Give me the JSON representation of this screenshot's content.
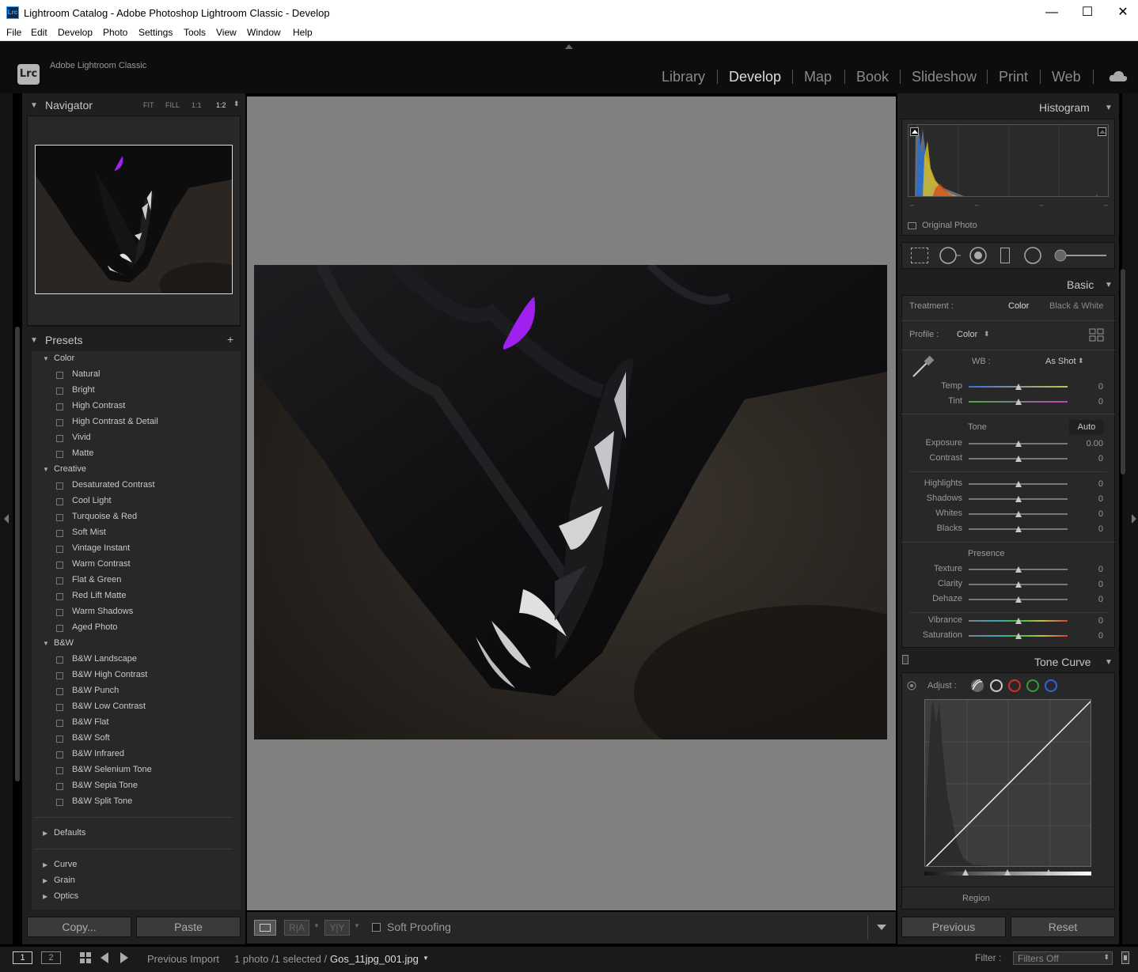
{
  "window": {
    "title": "Lightroom Catalog - Adobe Photoshop Lightroom Classic - Develop",
    "app_icon_text": "Lrc",
    "minimize": "—",
    "maximize": "☐",
    "close": "✕"
  },
  "menu": [
    "File",
    "Edit",
    "Develop",
    "Photo",
    "Settings",
    "Tools",
    "View",
    "Window",
    "Help"
  ],
  "identity": {
    "badge": "Lrc",
    "brand": "Adobe Lightroom Classic"
  },
  "modules": [
    "Library",
    "Develop",
    "Map",
    "Book",
    "Slideshow",
    "Print",
    "Web"
  ],
  "active_module": "Develop",
  "navigator": {
    "title": "Navigator",
    "zoom": [
      "FIT",
      "FILL",
      "1:1",
      "1:2"
    ],
    "active_zoom": "1:2"
  },
  "presets": {
    "title": "Presets",
    "groups": [
      {
        "name": "Color",
        "items": [
          "Natural",
          "Bright",
          "High Contrast",
          "High Contrast & Detail",
          "Vivid",
          "Matte"
        ]
      },
      {
        "name": "Creative",
        "items": [
          "Desaturated Contrast",
          "Cool Light",
          "Turquoise & Red",
          "Soft Mist",
          "Vintage Instant",
          "Warm Contrast",
          "Flat & Green",
          "Red Lift Matte",
          "Warm Shadows",
          "Aged Photo"
        ]
      },
      {
        "name": "B&W",
        "items": [
          "B&W Landscape",
          "B&W High Contrast",
          "B&W Punch",
          "B&W Low Contrast",
          "B&W Flat",
          "B&W Soft",
          "B&W Infrared",
          "B&W Selenium Tone",
          "B&W Sepia Tone",
          "B&W Split Tone"
        ]
      }
    ],
    "collapsed": [
      "Defaults",
      "Curve",
      "Grain",
      "Optics"
    ]
  },
  "left_buttons": {
    "copy": "Copy...",
    "paste": "Paste"
  },
  "toolbar": {
    "soft_proofing": "Soft Proofing"
  },
  "histogram": {
    "title": "Histogram",
    "original_photo": "Original Photo"
  },
  "basic": {
    "title": "Basic",
    "treatment_label": "Treatment :",
    "treatment_color": "Color",
    "treatment_bw": "Black & White",
    "profile_label": "Profile :",
    "profile_value": "Color",
    "wb_label": "WB :",
    "wb_value": "As Shot",
    "tone_label": "Tone",
    "auto": "Auto",
    "presence_label": "Presence",
    "sliders": {
      "temp": {
        "label": "Temp",
        "value": "0"
      },
      "tint": {
        "label": "Tint",
        "value": "0"
      },
      "exposure": {
        "label": "Exposure",
        "value": "0.00"
      },
      "contrast": {
        "label": "Contrast",
        "value": "0"
      },
      "highlights": {
        "label": "Highlights",
        "value": "0"
      },
      "shadows": {
        "label": "Shadows",
        "value": "0"
      },
      "whites": {
        "label": "Whites",
        "value": "0"
      },
      "blacks": {
        "label": "Blacks",
        "value": "0"
      },
      "texture": {
        "label": "Texture",
        "value": "0"
      },
      "clarity": {
        "label": "Clarity",
        "value": "0"
      },
      "dehaze": {
        "label": "Dehaze",
        "value": "0"
      },
      "vibrance": {
        "label": "Vibrance",
        "value": "0"
      },
      "saturation": {
        "label": "Saturation",
        "value": "0"
      }
    }
  },
  "tone_curve": {
    "title": "Tone Curve",
    "adjust_label": "Adjust :",
    "region": "Region"
  },
  "right_buttons": {
    "previous": "Previous",
    "reset": "Reset"
  },
  "filmstrip": {
    "page1": "1",
    "page2": "2",
    "source": "Previous Import",
    "count": "1 photo /1 selected /",
    "filename": "Gos_11jpg_001.jpg",
    "filter_label": "Filter :",
    "filter_value": "Filters Off"
  },
  "colors": {
    "eye": "#a020f0",
    "panel": "#1f1f1f",
    "canvas": "#808080"
  }
}
